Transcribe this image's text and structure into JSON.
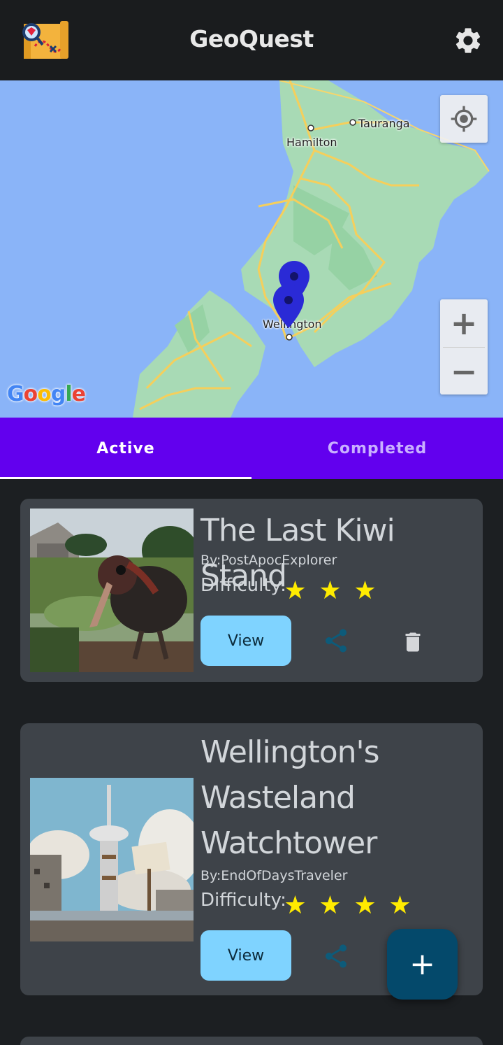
{
  "app": {
    "title": "GeoQuest"
  },
  "map": {
    "labels": {
      "tauranga": "Tauranga",
      "hamilton": "Hamilton",
      "wellington": "Wellington"
    },
    "attribution": [
      "G",
      "o",
      "o",
      "g",
      "l",
      "e"
    ],
    "zoom_in": "+",
    "zoom_out": "−"
  },
  "tabs": [
    {
      "label": "Active",
      "selected": true
    },
    {
      "label": "Completed",
      "selected": false
    }
  ],
  "quests": [
    {
      "title": "The Last Kiwi Stand",
      "author": "By:PostApocExplorer",
      "difficulty_label": "Difficulty:",
      "difficulty": 3,
      "view_label": "View"
    },
    {
      "title_lines": [
        "Wellington's",
        "Wasteland",
        "Watchtower"
      ],
      "author": "By:EndOfDaysTraveler",
      "difficulty_label": "Difficulty:",
      "difficulty": 4,
      "view_label": "View"
    }
  ],
  "fab_label": "+",
  "colors": {
    "app_bar": "#1a1c1e",
    "tab_bar": "#6200ee",
    "card": "#3e4349",
    "view_button": "#7fd3ff",
    "star": "#ffeb00",
    "fab": "#04496b",
    "map_water": "#8ab4f8",
    "map_land": "#a8dab5",
    "marker": "#2a2ad6"
  },
  "icons": {
    "logo": "treasure-map-icon",
    "settings": "gear-icon",
    "locate": "my-location-icon",
    "share": "share-icon",
    "delete": "trash-icon",
    "marker": "map-pin-icon"
  }
}
